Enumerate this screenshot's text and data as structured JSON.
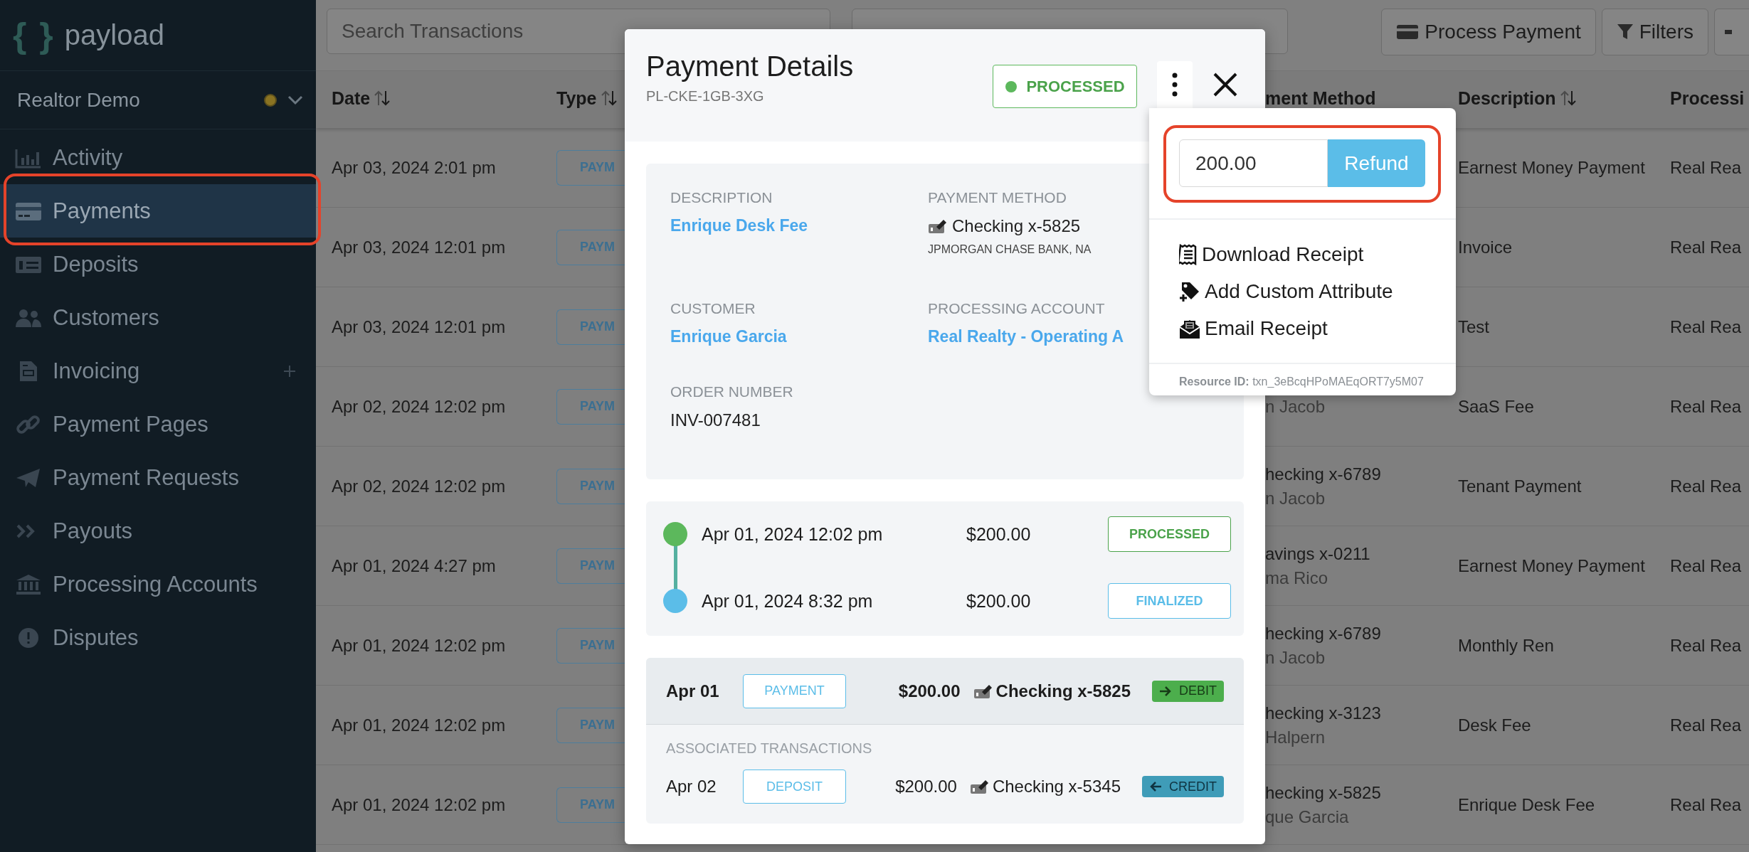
{
  "sidebar": {
    "logo": {
      "mark": "{ }",
      "name": "payload"
    },
    "org": {
      "name": "Realtor Demo"
    },
    "nav": [
      {
        "label": "Activity",
        "kind": "chart",
        "selected": false,
        "add": false,
        "highlight": false
      },
      {
        "label": "Payments",
        "kind": "card",
        "selected": true,
        "add": false,
        "highlight": true
      },
      {
        "label": "Deposits",
        "kind": "cash",
        "selected": false,
        "add": false,
        "highlight": false
      },
      {
        "label": "Customers",
        "kind": "users",
        "selected": false,
        "add": false,
        "highlight": false
      },
      {
        "label": "Invoicing",
        "kind": "doc",
        "selected": false,
        "add": true,
        "highlight": false
      },
      {
        "label": "Payment Pages",
        "kind": "link",
        "selected": false,
        "add": false,
        "highlight": false
      },
      {
        "label": "Payment Requests",
        "kind": "plane",
        "selected": false,
        "add": false,
        "highlight": false
      },
      {
        "label": "Payouts",
        "kind": "chevrons",
        "selected": false,
        "add": false,
        "highlight": false
      },
      {
        "label": "Processing Accounts",
        "kind": "bank",
        "selected": false,
        "add": false,
        "highlight": false
      },
      {
        "label": "Disputes",
        "kind": "alert",
        "selected": false,
        "add": false,
        "highlight": false
      }
    ]
  },
  "toolbar": {
    "search": {
      "placeholder": "Search Transactions"
    },
    "buttons": [
      {
        "label": "Process Payment",
        "kind": "card"
      },
      {
        "label": "Filters",
        "kind": "filter"
      },
      {
        "kind": "cut"
      }
    ]
  },
  "table": {
    "columns": [
      {
        "label": "Date",
        "sortable": true
      },
      {
        "label": "Type",
        "sortable": true
      },
      {
        "label": "ment Method",
        "sortable": false
      },
      {
        "label": "Description",
        "sortable": true
      },
      {
        "label": "Processi"
      }
    ],
    "rows": [
      {
        "date": "Apr 03, 2024 2:01 pm",
        "type": "PAYM",
        "description": "Earnest Money Payment",
        "account": "Real Rea"
      },
      {
        "date": "Apr 03, 2024 12:01 pm",
        "type": "PAYM",
        "description": "Invoice",
        "account": "Real Rea"
      },
      {
        "date": "Apr 03, 2024 12:01 pm",
        "type": "PAYM",
        "description": "Test",
        "account": "Real Rea"
      },
      {
        "date": "Apr 02, 2024 12:02 pm",
        "type": "PAYM",
        "method_sub": "n Jacob",
        "description": "SaaS Fee",
        "account": "Real Rea"
      },
      {
        "date": "Apr 02, 2024 12:02 pm",
        "type": "PAYM",
        "method": "hecking x-6789",
        "method_sub": "n Jacob",
        "description": "Tenant Payment",
        "account": "Real Rea"
      },
      {
        "date": "Apr 01, 2024 4:27 pm",
        "type": "PAYM",
        "method": "avings x-0211",
        "method_sub": "ma Rico",
        "description": "Earnest Money Payment",
        "account": "Real Rea"
      },
      {
        "date": "Apr 01, 2024 12:02 pm",
        "type": "PAYM",
        "method": "hecking x-6789",
        "method_sub": "n Jacob",
        "description": "Monthly Ren",
        "account": "Real Rea"
      },
      {
        "date": "Apr 01, 2024 12:02 pm",
        "type": "PAYM",
        "method": "hecking x-3123",
        "method_sub": "Halpern",
        "description": "Desk Fee",
        "account": "Real Rea"
      },
      {
        "date": "Apr 01, 2024 12:02 pm",
        "type": "PAYM",
        "method": "hecking x-5825",
        "method_sub": "que Garcia",
        "description": "Enrique Desk Fee",
        "account": "Real Rea"
      }
    ]
  },
  "payment_modal": {
    "title": "Payment Details",
    "reference": "PL-CKE-1GB-3XG",
    "status": {
      "label": "PROCESSED",
      "kind": "processed"
    },
    "details": [
      {
        "label": "DESCRIPTION",
        "value": "Enrique Desk Fee",
        "kind": "link"
      },
      {
        "label": "PAYMENT METHOD",
        "value": "Checking x-5825",
        "sub": "JPMORGAN CHASE BANK, NA",
        "kind": "method"
      },
      {
        "label": "CUSTOMER",
        "value": "Enrique Garcia",
        "kind": "link"
      },
      {
        "label": "PROCESSING ACCOUNT",
        "value": "Real Realty - Operating A",
        "kind": "link"
      },
      {
        "label": "ORDER NUMBER",
        "value": "INV-007481",
        "kind": "text"
      }
    ],
    "timeline": [
      {
        "date": "Apr 01, 2024 12:02 pm",
        "amount": "$200.00",
        "status": "PROCESSED",
        "kind": "processed"
      },
      {
        "date": "Apr 01, 2024 8:32 pm",
        "amount": "$200.00",
        "status": "FINALIZED",
        "kind": "finalized"
      }
    ],
    "transaction": {
      "date": "Apr 01",
      "type": "PAYMENT",
      "amount": "$200.00",
      "method": "Checking x-5825",
      "direction": "DEBIT",
      "kind": "debit"
    },
    "associated": {
      "heading": "ASSOCIATED TRANSACTIONS",
      "items": [
        {
          "date": "Apr 02",
          "type": "DEPOSIT",
          "amount": "$200.00",
          "method": "Checking x-5345",
          "direction": "CREDIT",
          "kind": "credit"
        }
      ]
    }
  },
  "actions_menu": {
    "refund": {
      "value": "200.00",
      "button": "Refund",
      "highlight": true
    },
    "items": [
      {
        "label": "Download Receipt",
        "kind": "receipt"
      },
      {
        "label": "Add Custom Attribute",
        "kind": "tag"
      },
      {
        "label": "Email Receipt",
        "kind": "email"
      }
    ],
    "resource_id": {
      "label": "Resource ID:",
      "value": "txn_3eBcqHPoMAEqORT7y5M07"
    }
  }
}
